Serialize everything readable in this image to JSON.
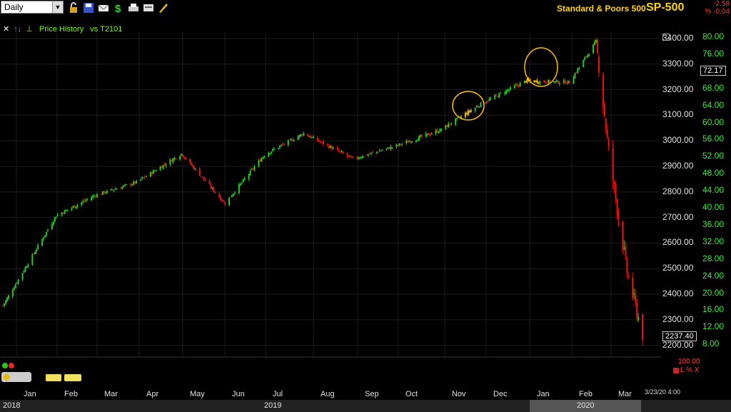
{
  "toolbar": {
    "period": "Daily",
    "icons": [
      "lock-icon",
      "save-icon",
      "mail-icon",
      "dollar-icon",
      "print-icon",
      "template-icon",
      "pencil-icon"
    ]
  },
  "header": {
    "symbol_desc": "Standard & Poors 500",
    "symbol": "SP-500",
    "change": "-2.58",
    "change_pct": "% -0.04"
  },
  "subbar": {
    "title": "Price History",
    "compare": "vs T2101"
  },
  "price_axis": [
    "3400.00",
    "3300.00",
    "3200.00",
    "3100.00",
    "3000.00",
    "2900.00",
    "2800.00",
    "2700.00",
    "2600.00",
    "2500.00",
    "2400.00",
    "2300.00",
    "2200.00"
  ],
  "indicator_axis": [
    "80.00",
    "76.00",
    "72.17",
    "68.00",
    "64.00",
    "60.00",
    "56.00",
    "52.00",
    "48.00",
    "44.00",
    "40.00",
    "36.00",
    "32.00",
    "28.00",
    "24.00",
    "20.00",
    "16.00",
    "12.00",
    "8.00"
  ],
  "current_price": "2237.40",
  "current_indicator": "72.17",
  "lower_panel": {
    "value": "100.00",
    "controls": "L % X"
  },
  "months": [
    "Jan",
    "Feb",
    "Mar",
    "Apr",
    "May",
    "Jun",
    "Jul",
    "Aug",
    "Sep",
    "Oct",
    "Nov",
    "Dec",
    "Jan",
    "Feb",
    "Mar"
  ],
  "years": [
    "2018",
    "2019",
    "2020"
  ],
  "date_stamp": "3/23/20 4:00",
  "colors": {
    "up": "#22cc22",
    "down": "#ee1111",
    "highlight": "#ffc000",
    "axis_green": "#33ee33"
  },
  "chart_data": {
    "type": "candlestick",
    "title": "Standard & Poors 500",
    "ylabel": "",
    "ylim": [
      2150,
      3430
    ],
    "x_start_label": "Dec 2018",
    "x_end_label": "Mar 23 2020",
    "closes_approx": [
      {
        "date": "2018-12-24",
        "close": 2351
      },
      {
        "date": "2019-01-31",
        "close": 2704
      },
      {
        "date": "2019-02-28",
        "close": 2784
      },
      {
        "date": "2019-03-29",
        "close": 2834
      },
      {
        "date": "2019-04-30",
        "close": 2946
      },
      {
        "date": "2019-05-31",
        "close": 2752
      },
      {
        "date": "2019-06-28",
        "close": 2942
      },
      {
        "date": "2019-07-26",
        "close": 3026
      },
      {
        "date": "2019-08-30",
        "close": 2926
      },
      {
        "date": "2019-09-30",
        "close": 2977
      },
      {
        "date": "2019-10-31",
        "close": 3038
      },
      {
        "date": "2019-11-29",
        "close": 3141
      },
      {
        "date": "2019-12-31",
        "close": 3231
      },
      {
        "date": "2020-01-31",
        "close": 3226
      },
      {
        "date": "2020-02-19",
        "close": 3386
      },
      {
        "date": "2020-02-28",
        "close": 2954
      },
      {
        "date": "2020-03-12",
        "close": 2481
      },
      {
        "date": "2020-03-23",
        "close": 2237
      }
    ],
    "highlighted_periods": [
      "Nov 2019",
      "Jan 2020"
    ]
  }
}
